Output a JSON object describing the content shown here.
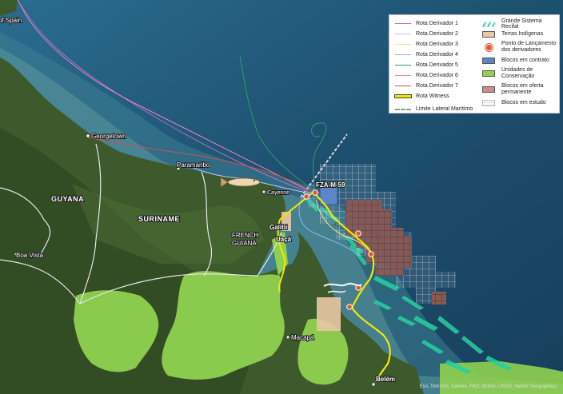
{
  "labels": {
    "spain": "of Spain",
    "georgetown": "Georgetown",
    "paramaribo": "Paramaribo",
    "cayenne": "Cayenne",
    "guyana": "GUYANA",
    "suriname": "SURINAME",
    "french_guiana_1": "FRENCH",
    "french_guiana_2": "GUIANA",
    "boa_vista": "Boa Vista",
    "fza": "FZA-M-59",
    "galibi": "Galibi",
    "uaca": "Uaçá",
    "macapa": "Macapá",
    "belem": "Belém"
  },
  "legend": {
    "left": [
      {
        "label": "Rota Derivador 1",
        "color": "#b16fc6",
        "type": "line"
      },
      {
        "label": "Rota Derivador 2",
        "color": "#b9c5f0",
        "type": "line"
      },
      {
        "label": "Rota Derivador 3",
        "color": "#f3e98a",
        "type": "line"
      },
      {
        "label": "Rota Derivador 4",
        "color": "#8ab3e6",
        "type": "line"
      },
      {
        "label": "Rota Derivador 5",
        "color": "#2e9b6b",
        "type": "line"
      },
      {
        "label": "Rota Derivador 6",
        "color": "#ea82bd",
        "type": "line"
      },
      {
        "label": "Rota Derivador 7",
        "color": "#d44e4e",
        "type": "line"
      },
      {
        "label": "Rota Witness",
        "color": "#f2e600",
        "type": "thick"
      },
      {
        "label": "Limite Lateral Marítimo",
        "color": "#9a9a9a",
        "type": "dash"
      }
    ],
    "right": [
      {
        "label": "Grande Sistema Recifal",
        "type": "reef"
      },
      {
        "label": "Terras Indígenas",
        "type": "box",
        "color": "#e9c8a6"
      },
      {
        "label": "Ponto de Lançamento dos derivadores",
        "type": "dot"
      },
      {
        "label": "Blocos em contrato",
        "type": "box",
        "color": "#5b86c8"
      },
      {
        "label": "Unidades de Conservação",
        "type": "box",
        "color": "#8fd14f"
      },
      {
        "label": "Blocos em oferta permanente",
        "type": "box",
        "color": "#c69085"
      },
      {
        "label": "Blocos em estudo",
        "type": "grid"
      }
    ]
  },
  "attribution": "Esri, TomTom, Garmin, FAO, NOAA, USGS, Vantor Geographics"
}
